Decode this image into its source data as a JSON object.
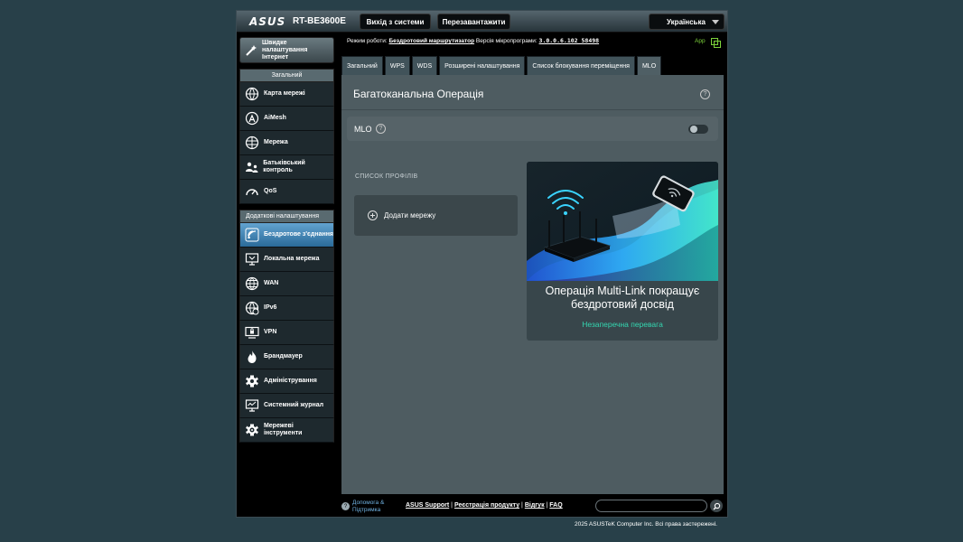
{
  "header": {
    "logo": "ASUS",
    "model": "RT-BE3600E",
    "logout_label": "Вихід з системи",
    "reboot_label": "Перезавантажити",
    "language": "Українська"
  },
  "sidebar": {
    "quick_setup": "Швидке налаштування Інтернет",
    "general_header": "Загальний",
    "general_items": [
      {
        "label": "Карта мережі",
        "icon": "network-map-icon"
      },
      {
        "label": "AiMesh",
        "icon": "aimesh-icon"
      },
      {
        "label": "Мережа",
        "icon": "globe-network-icon"
      },
      {
        "label": "Батьківський контроль",
        "icon": "parental-control-icon"
      },
      {
        "label": "QoS",
        "icon": "qos-gauge-icon"
      }
    ],
    "advanced_header": "Додаткові налаштування",
    "advanced_items": [
      {
        "label": "Бездротове з'єднання",
        "icon": "wireless-icon",
        "active": true
      },
      {
        "label": "Локальна мережа",
        "icon": "lan-icon"
      },
      {
        "label": "WAN",
        "icon": "wan-globe-icon"
      },
      {
        "label": "IPv6",
        "icon": "ipv6-icon"
      },
      {
        "label": "VPN",
        "icon": "vpn-icon"
      },
      {
        "label": "Брандмауер",
        "icon": "firewall-icon"
      },
      {
        "label": "Адміністрування",
        "icon": "administration-icon"
      },
      {
        "label": "Системний журнал",
        "icon": "system-log-icon"
      },
      {
        "label": "Мережеві інструменти",
        "icon": "network-tools-icon"
      }
    ]
  },
  "info": {
    "mode_label": "Режим роботи:",
    "mode_value": "Бездротовий маршрутизатор",
    "firmware_label": "Версія мікропрограми:",
    "firmware_value": "3.0.0.6.102_58498",
    "app_label": "App"
  },
  "tabs": [
    {
      "label": "Загальний"
    },
    {
      "label": "WPS"
    },
    {
      "label": "WDS"
    },
    {
      "label": "Розширені налаштування"
    },
    {
      "label": "Список блокування переміщення"
    },
    {
      "label": "MLO",
      "active": true
    }
  ],
  "main": {
    "title": "Багатоканальна Операція",
    "mlo_label": "MLO",
    "mlo_enabled": false,
    "profile_list_label": "СПИСОК ПРОФІЛІВ",
    "add_network_label": "Додати мережу",
    "promo_title": "Операція Multi-Link покращує бездротовий досвід",
    "promo_link": "Незаперечна перевага"
  },
  "footer": {
    "help_label": "Допомога & Підтримка",
    "links": [
      "ASUS Support",
      "Реєстрація продукту",
      "Відгук",
      "FAQ"
    ],
    "search_value": "",
    "copyright": "2025 ASUSTeK Computer Inc. Всі права застережені."
  },
  "colors": {
    "accent_active": "#2a6a99",
    "link_green": "#34d6b0",
    "app_green": "#7cd23a",
    "help_blue": "#6fb1e0"
  }
}
